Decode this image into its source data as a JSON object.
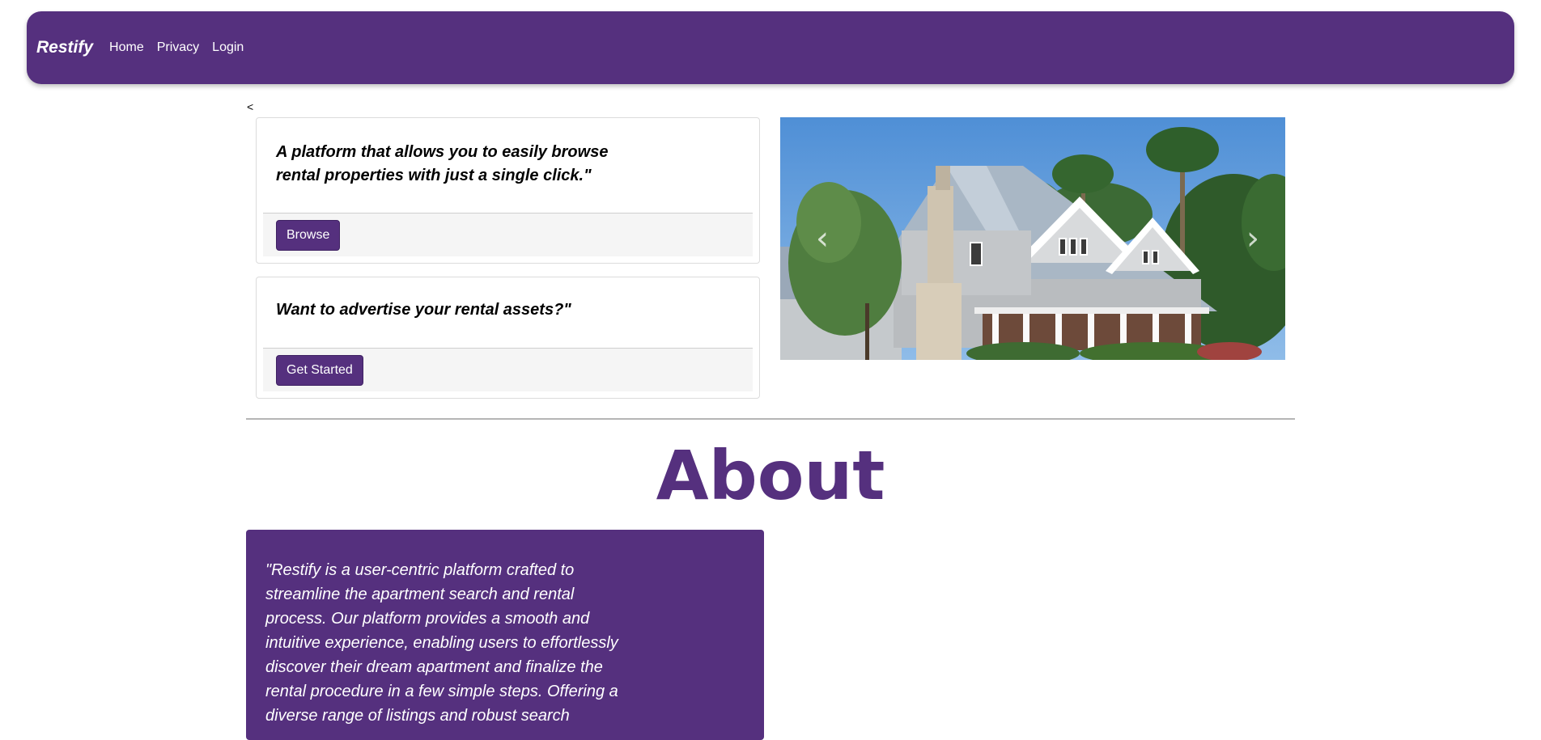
{
  "navbar": {
    "brand": "Restify",
    "links": [
      "Home",
      "Privacy",
      "Login"
    ]
  },
  "carousel": {
    "back_label": "<",
    "prev_symbol": "‹",
    "next_symbol": "›"
  },
  "cards": [
    {
      "text": "A platform that allows you to easily browse rental properties with just a single click.\"",
      "button": "Browse"
    },
    {
      "text": "Want to advertise your rental assets?\"",
      "button": "Get Started"
    }
  ],
  "about": {
    "title": "About",
    "text": "\"Restify is a user-centric platform crafted to streamline the apartment search and rental process. Our platform provides a smooth and intuitive experience, enabling users to effortlessly discover their dream apartment and finalize the rental procedure in a few simple steps. Offering a diverse range of listings and robust search"
  },
  "colors": {
    "brand_purple": "#55307e"
  }
}
